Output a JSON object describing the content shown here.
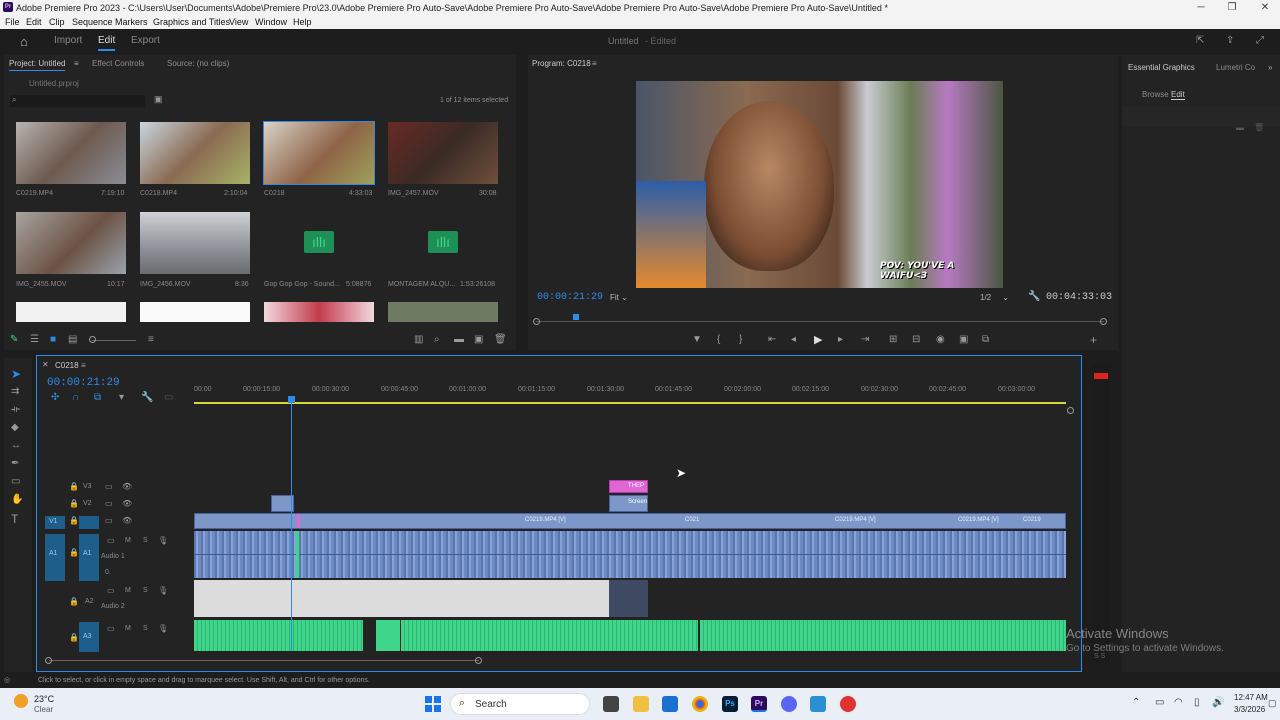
{
  "window": {
    "title": "Adobe Premiere Pro 2023 - C:\\Users\\User\\Documents\\Adobe\\Premiere Pro\\23.0\\Adobe Premiere Pro Auto-Save\\Adobe Premiere Pro Auto-Save\\Adobe Premiere Pro Auto-Save\\Adobe Premiere Pro Auto-Save\\Untitled *"
  },
  "menu": [
    "File",
    "Edit",
    "Clip",
    "Sequence",
    "Markers",
    "Graphics and Titles",
    "View",
    "Window",
    "Help"
  ],
  "workspace": {
    "tabs": [
      "Import",
      "Edit",
      "Export"
    ],
    "project_name": "Untitled",
    "project_status": "- Edited"
  },
  "project_panel": {
    "tabs": [
      "Project: Untitled",
      "Effect Controls",
      "Source: (no clips)"
    ],
    "file": "Untitled.prproj",
    "count": "1 of 12 items selected",
    "items": [
      {
        "name": "C0219.MP4",
        "dur": "7:19:10"
      },
      {
        "name": "C0218.MP4",
        "dur": "2:10:04"
      },
      {
        "name": "C0218",
        "dur": "4:33:03"
      },
      {
        "name": "IMG_2457.MOV",
        "dur": "30:08"
      },
      {
        "name": "IMG_2455.MOV",
        "dur": "10:17"
      },
      {
        "name": "IMG_2456.MOV",
        "dur": "8:36"
      },
      {
        "name": "Gop Gop Gop - Sound...",
        "dur": "5:08876"
      },
      {
        "name": "MONTAGEM ALQU...",
        "dur": "1:53:26108"
      }
    ]
  },
  "program": {
    "tab": "Program: C0218",
    "timecode": "00:00:21:29",
    "fit": "Fit",
    "resolution": "1/2",
    "duration": "00:04:33:03",
    "caption": "POV: YOU'VE A WAIFU<3"
  },
  "right_panel": {
    "tabs": [
      "Essential Graphics",
      "Lumetri Co"
    ],
    "subtabs": [
      "Browse",
      "Edit"
    ]
  },
  "timeline": {
    "sequence": "C0218",
    "timecode": "00:00:21:29",
    "ruler": [
      "00:00",
      "00:00:15:00",
      "00:00:30:00",
      "00:00:45:00",
      "00:01:00:00",
      "00:01:15:00",
      "00:01:30:00",
      "00:01:45:00",
      "00:02:00:00",
      "00:02:15:00",
      "00:02:30:00",
      "00:02:45:00",
      "00:03:00:00"
    ],
    "tracks": [
      "V3",
      "V2",
      "V1",
      "A1",
      "A2",
      "A3"
    ],
    "track_names": {
      "a1": "Audio 1",
      "a2": "Audio 2",
      "a1_level": "0."
    },
    "clips": {
      "title": "THEP",
      "screen": "Screen",
      "v1a": "C0219.MP4 [V]",
      "v1b": "C021",
      "v1c": "C0219.MP4 [V]",
      "v1d": "C0219.MP4 [V]",
      "v1e": "C0219"
    },
    "source_labels": [
      "V1",
      "A1"
    ]
  },
  "status_bar": "Click to select, or click in empty space and drag to marquee select. Use Shift, Alt, and Ctrl for other options.",
  "watermark": {
    "line1": "Activate Windows",
    "line2": "Go to Settings to activate Windows."
  },
  "taskbar": {
    "temp": "23°C",
    "weather": "Clear",
    "search": "Search",
    "time": "12:47 AM",
    "date": "3/3/2026"
  },
  "colors": {
    "accent": "#2d8ceb",
    "video_clip": "#7d97c8",
    "audio_clip": "#6e8ac2",
    "music_clip": "#3fd68c",
    "title_clip": "#e066d5"
  }
}
